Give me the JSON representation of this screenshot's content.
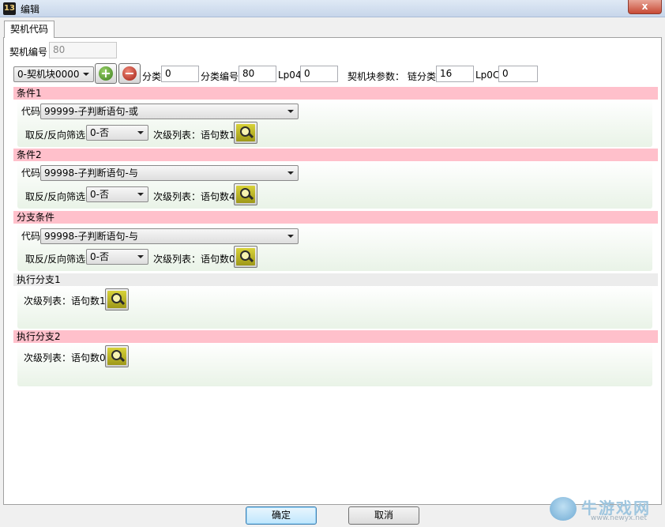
{
  "window": {
    "icon_text": "13",
    "title": "编辑",
    "close_glyph": "x"
  },
  "tab": {
    "label": "契机代码"
  },
  "top": {
    "id_label": "契机编号",
    "id_value": "80",
    "block_select": "0-契机块0000",
    "add_glyph": "+",
    "remove_glyph": "−",
    "category_label": "分类",
    "category_value": "0",
    "category_no_label": "分类编号",
    "category_no_value": "80",
    "lp04_label": "Lp04",
    "lp04_value": "0",
    "params_label": "契机块参数：",
    "chain_label": "链分类",
    "chain_value": "16",
    "lp0c_label": "Lp0C",
    "lp0c_value": "0"
  },
  "sections": {
    "cond1": {
      "title": "条件1",
      "code_label": "代码",
      "code_value": "99999-子判断语句-或",
      "filter_label": "取反/反向筛选",
      "filter_value": "0-否",
      "sub_label": "次级列表：语句数1"
    },
    "cond2": {
      "title": "条件2",
      "code_label": "代码",
      "code_value": "99998-子判断语句-与",
      "filter_label": "取反/反向筛选",
      "filter_value": "0-否",
      "sub_label": "次级列表：语句数4"
    },
    "branch_cond": {
      "title": "分支条件",
      "code_label": "代码",
      "code_value": "99998-子判断语句-与",
      "filter_label": "取反/反向筛选",
      "filter_value": "0-否",
      "sub_label": "次级列表：语句数0"
    },
    "exec1": {
      "title": "执行分支1",
      "sub_label": "次级列表：语句数1"
    },
    "exec2": {
      "title": "执行分支2",
      "sub_label": "次级列表：语句数0"
    }
  },
  "footer": {
    "ok_label": "确定",
    "cancel_label": "取消"
  },
  "watermark": {
    "text": "牛游戏网",
    "sub": "www.newyx.net"
  }
}
